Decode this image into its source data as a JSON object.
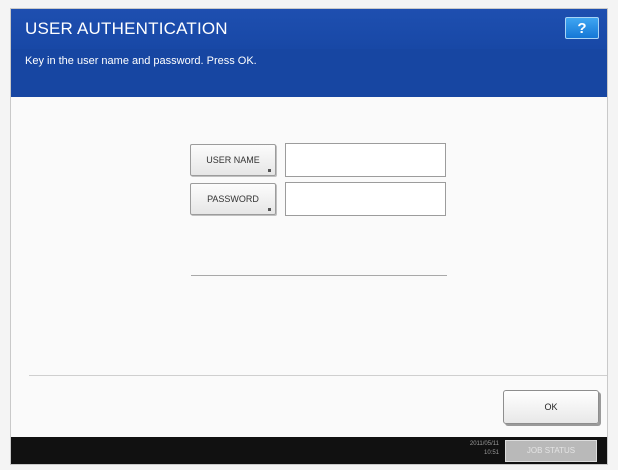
{
  "header": {
    "title": "USER AUTHENTICATION",
    "help_label": "?",
    "instruction": "Key in the user name and password. Press OK."
  },
  "form": {
    "username_label": "USER NAME",
    "username_value": "",
    "password_label": "PASSWORD",
    "password_value": ""
  },
  "footer": {
    "ok_label": "OK"
  },
  "status_bar": {
    "date": "2011/05/11",
    "time": "10:51",
    "job_status_label": "JOB STATUS"
  },
  "colors": {
    "title_bar": "#1e4fb0",
    "instruction_bar": "#1746a2",
    "help_button": "#1f86e0",
    "status_bar": "#111111"
  },
  "icons": {
    "help": "question-mark-icon"
  }
}
